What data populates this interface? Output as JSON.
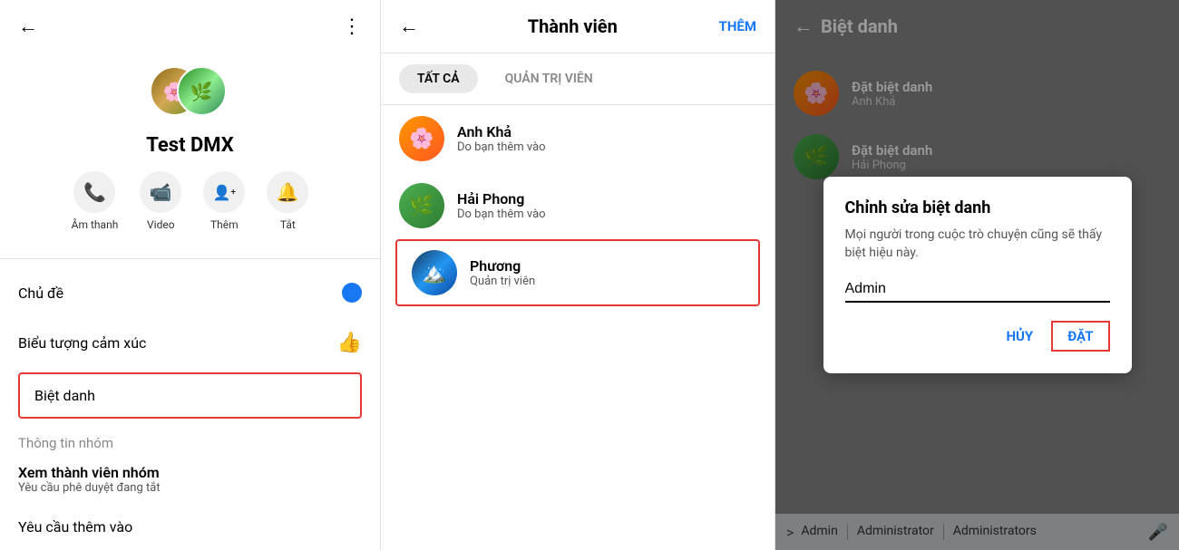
{
  "panel1": {
    "back_label": "←",
    "more_label": "⋮",
    "group_name": "Test DMX",
    "actions": [
      {
        "icon": "📞",
        "label": "Âm thanh",
        "key": "audio"
      },
      {
        "icon": "📹",
        "label": "Video",
        "key": "video"
      },
      {
        "icon": "👤+",
        "label": "Thêm",
        "key": "add"
      },
      {
        "icon": "🔔",
        "label": "Tắt",
        "key": "mute"
      }
    ],
    "menu_items": [
      {
        "label": "Chủ đề",
        "icon": "circle",
        "key": "theme"
      },
      {
        "label": "Biểu tượng cảm xúc",
        "icon": "thumb",
        "key": "emoji"
      },
      {
        "label": "Biệt danh",
        "highlighted": true,
        "key": "nickname"
      }
    ],
    "section_label": "Thông tin nhóm",
    "group_section": {
      "title": "Xem thành viên nhóm",
      "sub": "Yêu cầu phê duyệt đang tắt"
    },
    "bottom_item": "Yêu cầu thêm vào"
  },
  "panel2": {
    "back_label": "←",
    "title": "Thành viên",
    "add_label": "THÊM",
    "tabs": [
      {
        "label": "TẤT CẢ",
        "active": true
      },
      {
        "label": "QUẢN TRỊ VIÊN",
        "active": false
      }
    ],
    "members": [
      {
        "name": "Anh Khả",
        "sub": "Do bạn thêm vào",
        "avatar": "anh-kha",
        "highlighted": false
      },
      {
        "name": "Hải Phong",
        "sub": "Do bạn thêm vào",
        "avatar": "hai-phong",
        "highlighted": false
      },
      {
        "name": "Phương",
        "sub": "Quản trị viên",
        "avatar": "phuong",
        "highlighted": true
      }
    ]
  },
  "panel3": {
    "back_label": "←",
    "title": "Biệt danh",
    "members": [
      {
        "name": "Đặt biệt danh",
        "sub": "Anh Khả",
        "avatar": "anh-kha"
      },
      {
        "name": "Đặt biệt danh",
        "sub": "Hải Phong",
        "avatar": "hai-phong"
      }
    ],
    "modal": {
      "title": "Chỉnh sửa biệt danh",
      "desc": "Mọi người trong cuộc trò chuyện cũng sẽ thấy biệt hiệu này.",
      "input_value": "Admin",
      "cancel_label": "HỦY",
      "set_label": "ĐẶT"
    },
    "keyboard": {
      "chevron": ">",
      "suggestions": [
        "Admin",
        "Administrator",
        "Administrators"
      ],
      "mic": "🎤"
    }
  }
}
